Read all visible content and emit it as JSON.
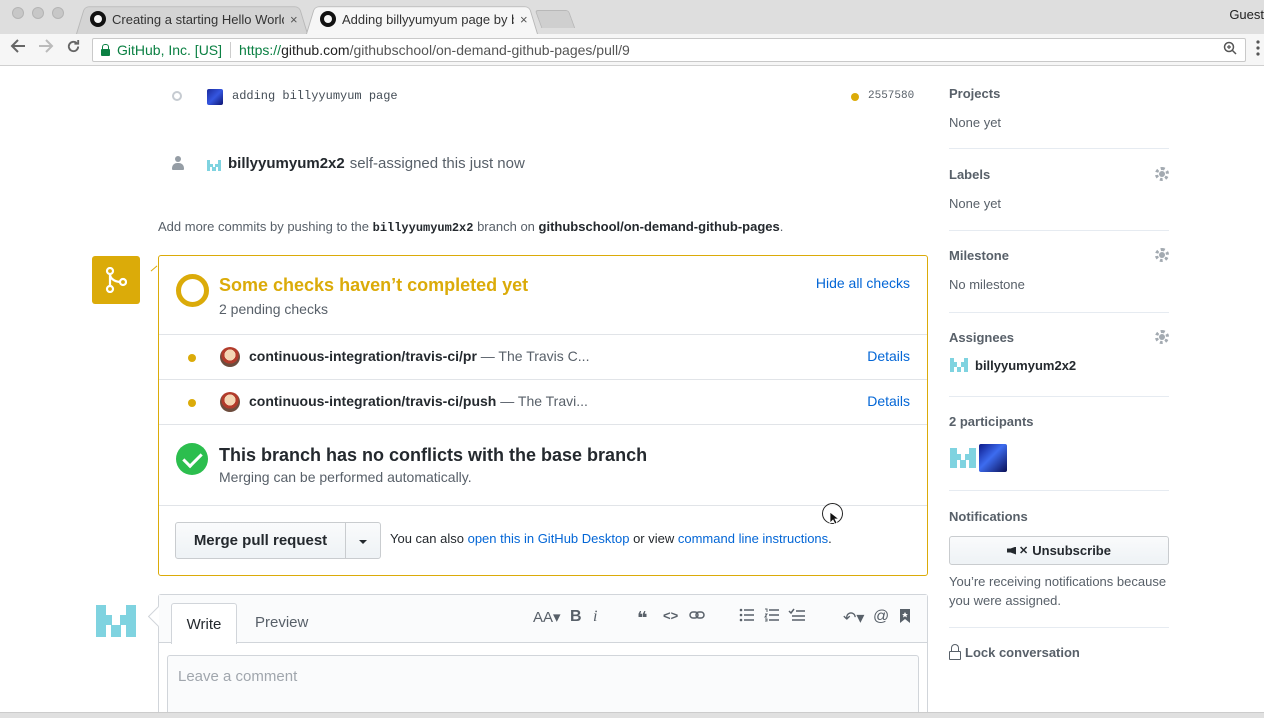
{
  "browser": {
    "tabs": [
      {
        "title": "Creating a starting Hello World",
        "close": "×"
      },
      {
        "title": "Adding billyyumyum page by b",
        "close": "×"
      }
    ],
    "profile": "Guest",
    "security_label": "GitHub, Inc. [US]",
    "url_scheme": "https://",
    "url_host": "github.com",
    "url_path": "/githubschool/on-demand-github-pages/pull/9",
    "icons": {
      "back": "back-arrow-icon",
      "forward": "forward-arrow-icon",
      "reload": "reload-icon",
      "zoom": "zoom-icon",
      "menu": "menu-dots-icon"
    }
  },
  "timeline": {
    "commit_message": "adding billyyumyum page",
    "commit_sha": "2557580",
    "assign_user": "billyyumyum2x2",
    "assign_text": "self-assigned this just now",
    "more_commits": {
      "prefix": "Add more commits by pushing to the",
      "branch": "billyyumyum2x2",
      "middle": "branch on",
      "repo": "githubschool/on-demand-github-pages",
      "suffix": "."
    }
  },
  "merge": {
    "status_color": "#dbab09",
    "checks_title": "Some checks haven’t completed yet",
    "checks_subtitle": "2 pending checks",
    "hide_checks": "Hide all checks",
    "checks": [
      {
        "name": "continuous-integration/travis-ci/pr",
        "desc": " — The Travis C...",
        "details": "Details"
      },
      {
        "name": "continuous-integration/travis-ci/push",
        "desc": " — The Travi...",
        "details": "Details"
      }
    ],
    "conflict_title": "This branch has no conflicts with the base branch",
    "conflict_subtitle": "Merging can be performed automatically.",
    "merge_button": "Merge pull request",
    "also_prefix": "You can also ",
    "desktop_link": "open this in GitHub Desktop",
    "also_middle": " or view ",
    "cli_link": "command line instructions",
    "also_suffix": "."
  },
  "comment": {
    "tab_write": "Write",
    "tab_preview": "Preview",
    "placeholder": "Leave a comment",
    "tools": {
      "heading": "AA▾",
      "bold": "B",
      "italic": "i",
      "quote": "❝",
      "code": "<>",
      "link": "⊃",
      "ul": "☰",
      "ol": "☷",
      "tasks": "☑",
      "reply": "↶▾",
      "mention": "@",
      "saved": "⬛"
    }
  },
  "sidebar": {
    "projects": {
      "label": "Projects",
      "value": "None yet"
    },
    "labels": {
      "label": "Labels",
      "value": "None yet"
    },
    "milestone": {
      "label": "Milestone",
      "value": "No milestone"
    },
    "assignees": {
      "label": "Assignees",
      "value": "billyyumyum2x2"
    },
    "participants": {
      "label": "2 participants"
    },
    "notifications": {
      "label": "Notifications",
      "button": "Unsubscribe",
      "text": "You’re receiving notifications because you were assigned."
    },
    "lock": "Lock conversation"
  }
}
